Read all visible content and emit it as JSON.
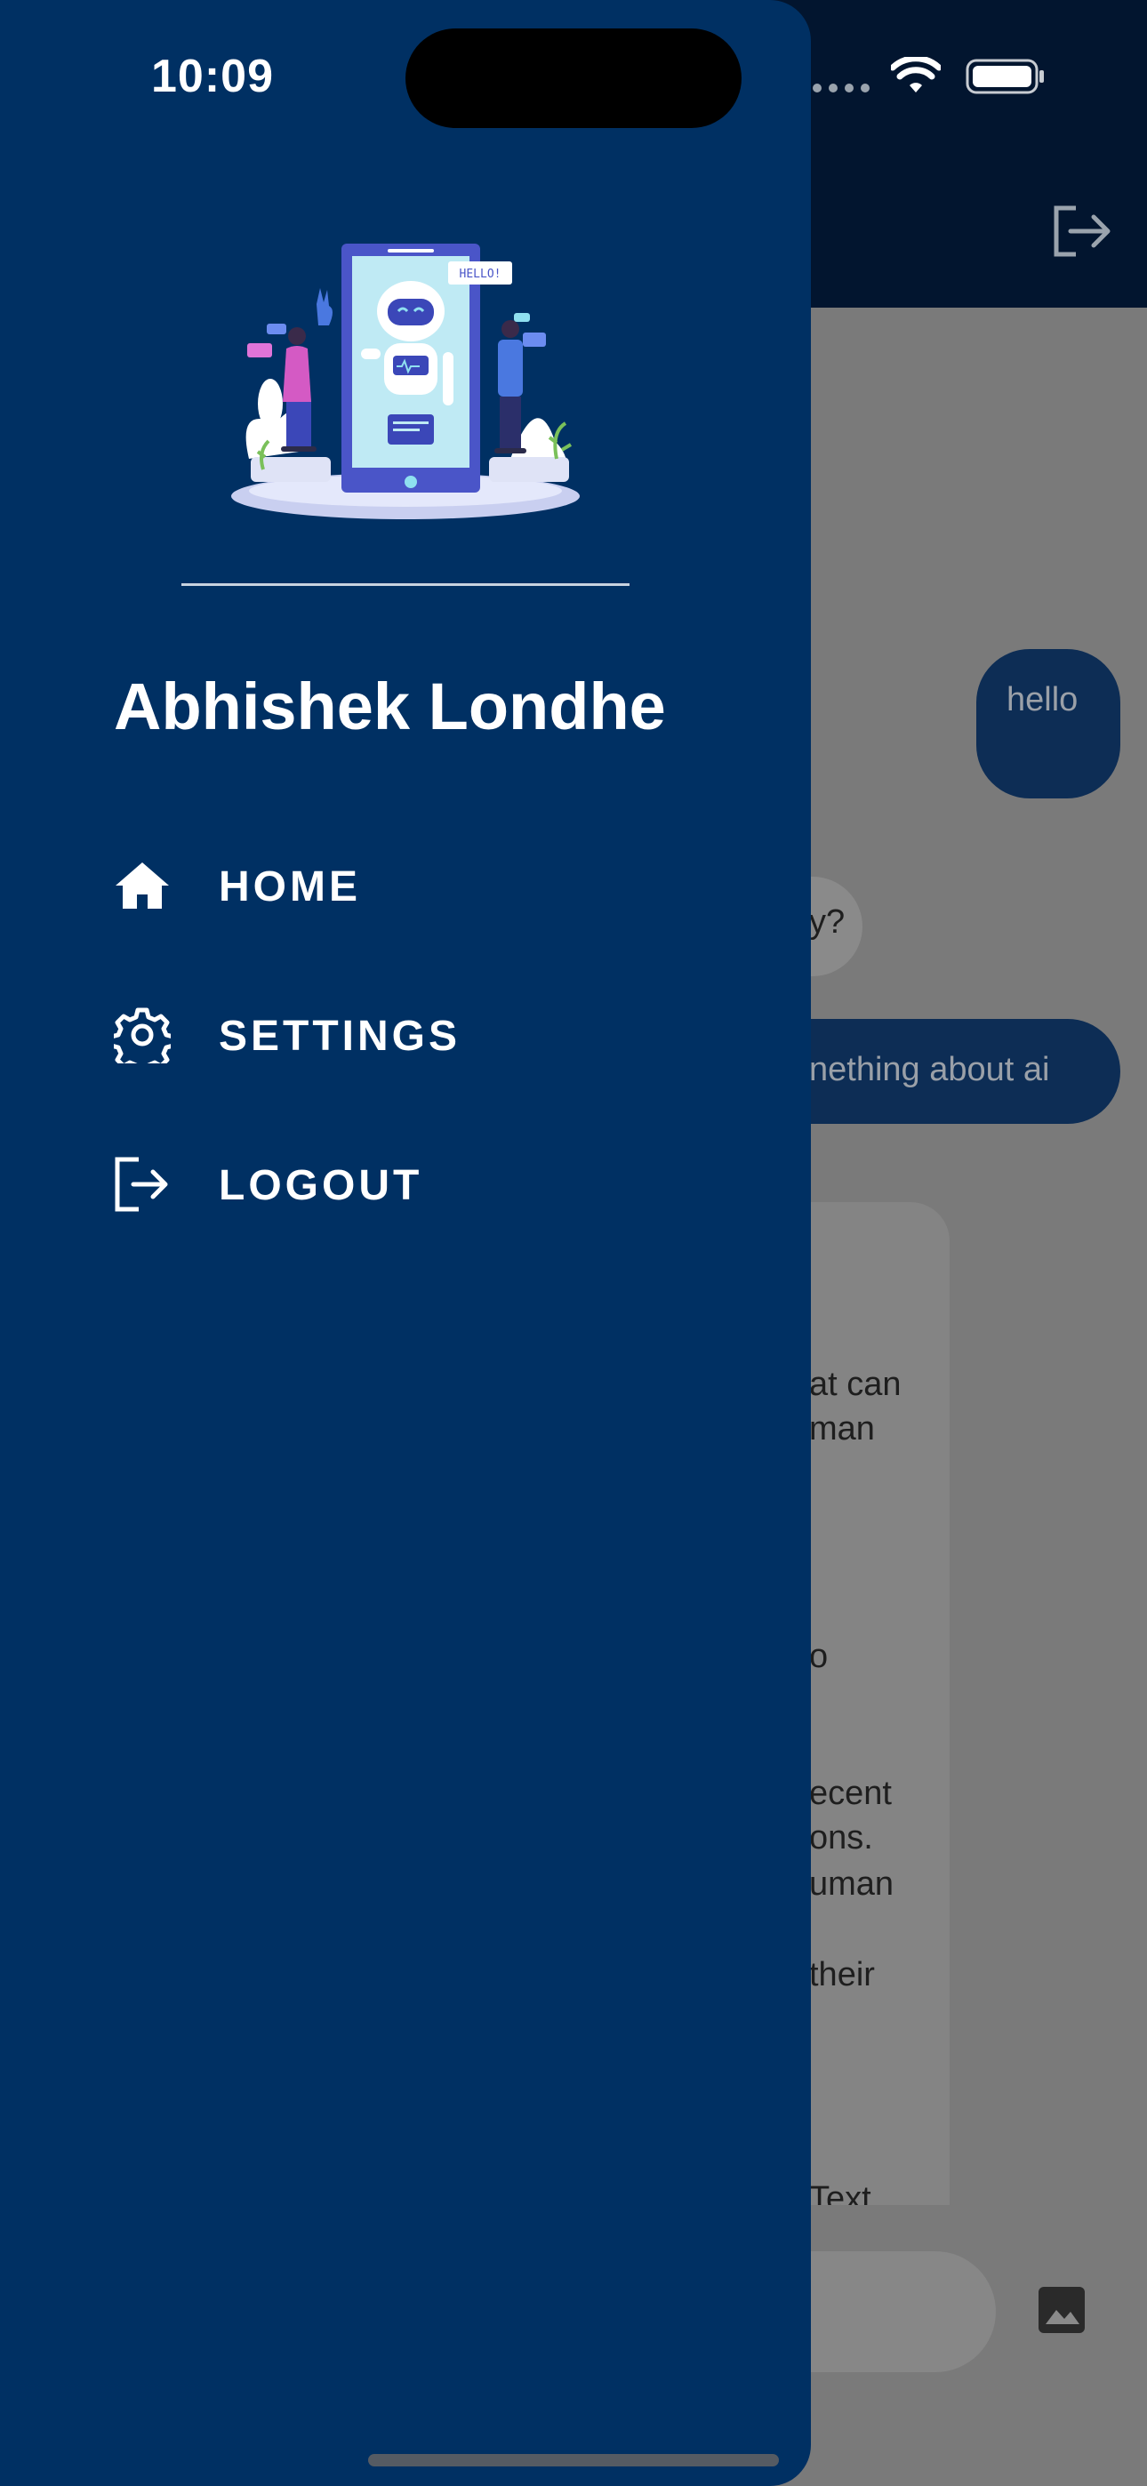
{
  "status_bar": {
    "time": "10:09"
  },
  "drawer": {
    "user_name": "Abhishek Londhe",
    "illustration_text": "HELLO!",
    "menu": [
      {
        "label": "HOME",
        "icon": "home-icon"
      },
      {
        "label": "SETTINGS",
        "icon": "gear-icon"
      },
      {
        "label": "LOGOUT",
        "icon": "logout-icon"
      }
    ]
  },
  "chat": {
    "messages": [
      {
        "role": "user",
        "text": "hello"
      },
      {
        "role": "bot",
        "text_visible": "y?"
      },
      {
        "role": "user",
        "text_visible": "nething about ai"
      },
      {
        "role": "bot",
        "lines_visible": [
          "at can",
          "man",
          "o",
          "ecent",
          "ons.",
          "uman",
          "their",
          "Text"
        ]
      }
    ],
    "action_icons": [
      "logout-icon",
      "image-icon"
    ]
  },
  "colors": {
    "drawer": "#003063",
    "app_bar": "#02152f",
    "scrim": "#7a7a7a",
    "user_bubble": "#0d2d55"
  }
}
